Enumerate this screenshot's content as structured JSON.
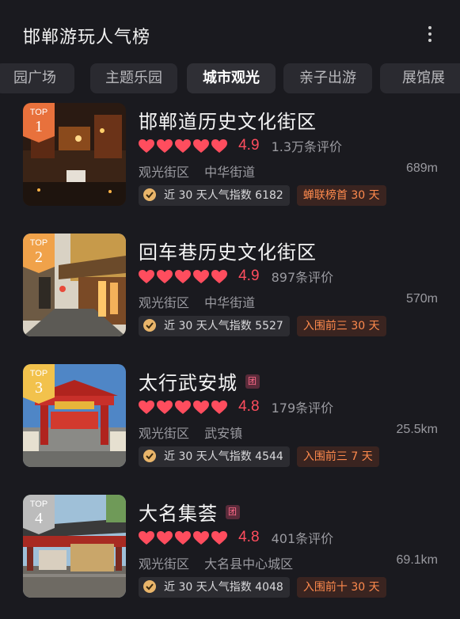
{
  "header": {
    "title": "邯郸游玩人气榜"
  },
  "tabs": [
    {
      "label": "园广场",
      "active": false
    },
    {
      "label": "主题乐园",
      "active": false
    },
    {
      "label": "城市观光",
      "active": true
    },
    {
      "label": "亲子出游",
      "active": false
    },
    {
      "label": "展馆展",
      "active": false
    }
  ],
  "badge_top_label": "TOP",
  "items": [
    {
      "rank": "1",
      "name": "邯郸道历史文化街区",
      "group": "",
      "hearts": 5,
      "score": "4.9",
      "reviews": "1.3万条评价",
      "category": "观光街区",
      "area": "中华街道",
      "distance": "689m",
      "popularity": "近 30 天人气指数 6182",
      "rank_tag": "蝉联榜首 30 天",
      "badge_color": "#e8713c"
    },
    {
      "rank": "2",
      "name": "回车巷历史文化街区",
      "group": "",
      "hearts": 5,
      "score": "4.9",
      "reviews": "897条评价",
      "category": "观光街区",
      "area": "中华街道",
      "distance": "570m",
      "popularity": "近 30 天人气指数 5527",
      "rank_tag": "入围前三 30 天",
      "badge_color": "#f0a24a"
    },
    {
      "rank": "3",
      "name": "太行武安城",
      "group": "团",
      "hearts": 5,
      "score": "4.8",
      "reviews": "179条评价",
      "category": "观光街区",
      "area": "武安镇",
      "distance": "25.5km",
      "popularity": "近 30 天人气指数 4544",
      "rank_tag": "入围前三 7 天",
      "badge_color": "#f2c24c"
    },
    {
      "rank": "4",
      "name": "大名集荟",
      "group": "团",
      "hearts": 5,
      "score": "4.8",
      "reviews": "401条评价",
      "category": "观光街区",
      "area": "大名县中心城区",
      "distance": "69.1km",
      "popularity": "近 30 天人气指数 4048",
      "rank_tag": "入围前十 30 天",
      "badge_color": "#bcbcbc"
    }
  ],
  "colors": {
    "heart": "#ff4d5e",
    "score": "#ff4d5e",
    "rank_tag": "#ff8a4d",
    "background": "#1a1a1f"
  }
}
